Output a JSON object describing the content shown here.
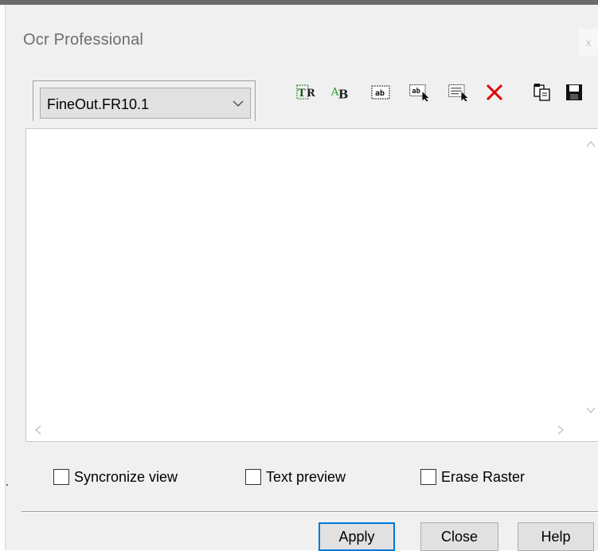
{
  "window": {
    "title": "Ocr Professional",
    "close_glyph": "x"
  },
  "combo": {
    "value": "FineOut.FR10.1",
    "arrow_icon": "chevron-down-icon"
  },
  "toolbar": {
    "tools": [
      {
        "name": "text-recognition-icon",
        "glyph": "TR"
      },
      {
        "name": "alphabet-icon",
        "glyph": "A B"
      },
      {
        "name": "text-region-icon",
        "glyph": "ab"
      },
      {
        "name": "select-text-region-icon",
        "glyph": "ab"
      },
      {
        "name": "select-region-icon",
        "glyph": ""
      },
      {
        "name": "delete-icon",
        "glyph": "×"
      },
      {
        "name": "copy-icon",
        "glyph": ""
      },
      {
        "name": "save-icon",
        "glyph": ""
      }
    ],
    "accent_green": "#1a7a1a",
    "accent_red": "#e00000"
  },
  "scroll": {
    "up": "^",
    "down": "v",
    "left": "<",
    "right": ">"
  },
  "options": {
    "sync_view": "Syncronize view",
    "text_preview": "Text preview",
    "erase_raster": "Erase Raster"
  },
  "buttons": {
    "apply": "Apply",
    "close": "Close",
    "help": "Help"
  },
  "colors": {
    "default_button_border": "#0078d7"
  }
}
